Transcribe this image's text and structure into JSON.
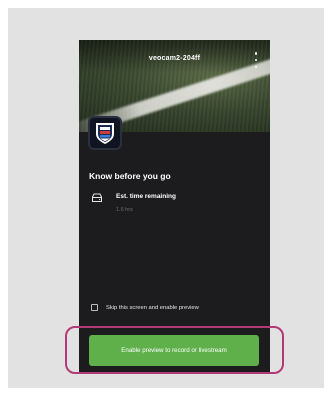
{
  "colors": {
    "accent_green": "#5fb04b",
    "highlight_magenta": "#b23a75",
    "panel_dark": "#1c1c1e"
  },
  "header": {
    "camera_name": "veocam2-204ff",
    "menu_icon": "kebab-menu-icon"
  },
  "badge": {
    "icon": "club-crest-icon"
  },
  "main": {
    "heading": "Know before you go",
    "info_rows": [
      {
        "icon": "camera-storage-icon",
        "title": "Est. time remaining",
        "value": "1.6 hrs"
      }
    ],
    "skip_checkbox": {
      "label": "Skip this screen and enable preview",
      "checked": false
    },
    "primary_button": {
      "label": "Enable preview to record or livestream"
    }
  }
}
